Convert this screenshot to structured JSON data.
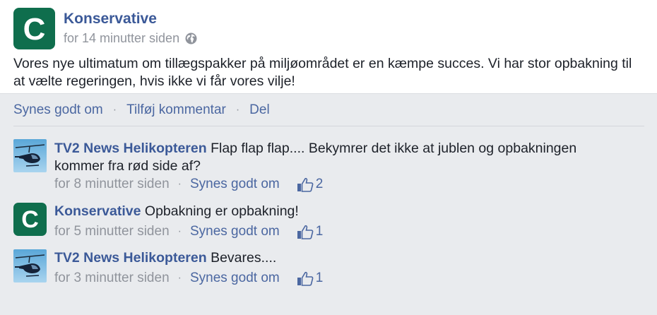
{
  "post": {
    "author": "Konservative",
    "avatar_letter": "C",
    "time": "for 14 minutter siden",
    "text": "Vores nye ultimatum om tillægspakker på miljøområdet er en kæmpe succes. Vi har stor opbakning til at vælte regeringen, hvis ikke vi får vores vilje!"
  },
  "actions": {
    "like": "Synes godt om",
    "comment": "Tilføj kommentar",
    "share": "Del",
    "separator": "·"
  },
  "comments": [
    {
      "author": "TV2 News Helikopteren",
      "text": "Flap flap flap....  Bekymrer det ikke at jublen og opbakningen kommer fra rød side af?",
      "time": "for 8 minutter siden",
      "like_label": "Synes godt om",
      "likes": "2"
    },
    {
      "author": "Konservative",
      "avatar_letter": "C",
      "text": "Opbakning er opbakning!",
      "time": "for 5 minutter siden",
      "like_label": "Synes godt om",
      "likes": "1"
    },
    {
      "author": "TV2 News Helikopteren",
      "text": "Bevares....",
      "time": "for 3 minutter siden",
      "like_label": "Synes godt om",
      "likes": "1"
    }
  ],
  "colors": {
    "brand_green": "#0f6e4d",
    "link_blue": "#3b5998",
    "meta_gray": "#90949c",
    "background": "#e9ebee"
  },
  "icons": {
    "globe": "globe-icon",
    "thumb": "thumbs-up-icon",
    "helicopter": "helicopter-avatar"
  }
}
